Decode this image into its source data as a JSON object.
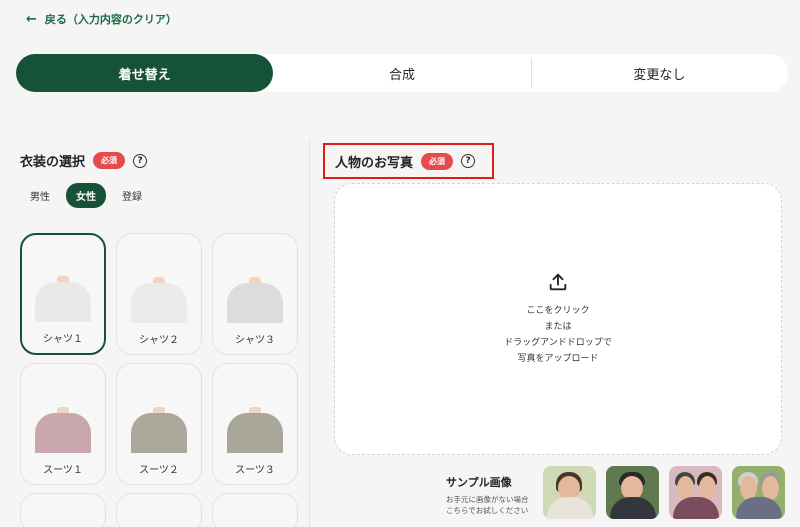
{
  "back": {
    "label": "戻る（入力内容のクリア）"
  },
  "tabs": [
    "着せ替え",
    "合成",
    "変更なし"
  ],
  "costume": {
    "title": "衣装の選択",
    "required": "必須",
    "help": "?",
    "filters": [
      "男性",
      "女性",
      "登録"
    ],
    "active_filter": "女性",
    "items": [
      {
        "label": "シャツ１",
        "color": "#e9e9ea"
      },
      {
        "label": "シャツ２",
        "color": "#ecebeb"
      },
      {
        "label": "シャツ３",
        "color": "#dcdcde"
      },
      {
        "label": "スーツ１",
        "color": "#c9a7ad"
      },
      {
        "label": "スーツ２",
        "color": "#aca99c"
      },
      {
        "label": "スーツ３",
        "color": "#a9a69a"
      }
    ]
  },
  "person": {
    "title": "人物のお写真",
    "required": "必須",
    "help": "?",
    "upload_lines": [
      "ここをクリック",
      "または",
      "ドラッグアンドドロップで",
      "写真をアップロード"
    ]
  },
  "samples": {
    "title": "サンプル画像",
    "subtitle_1": "お手元に画像がない場合",
    "subtitle_2": "こちらでお試しください",
    "count": 4
  },
  "colors": {
    "accent": "#155237",
    "required": "#e64a4a",
    "highlight": "#e01b1b"
  }
}
